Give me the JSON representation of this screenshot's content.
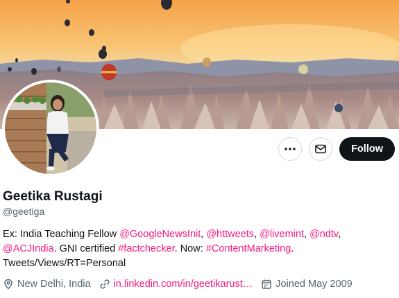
{
  "profile": {
    "name": "Geetika Rustagi",
    "handle": "@geetiga",
    "bio": [
      {
        "text": "Ex: India Teaching Fellow ",
        "link": false
      },
      {
        "text": "@GoogleNewsInit",
        "link": true
      },
      {
        "text": ", ",
        "link": false
      },
      {
        "text": "@httweets",
        "link": true
      },
      {
        "text": ", ",
        "link": false
      },
      {
        "text": "@livemint",
        "link": true
      },
      {
        "text": ", ",
        "link": false
      },
      {
        "text": "@ndtv",
        "link": true
      },
      {
        "text": ", ",
        "link": false
      },
      {
        "text": "@ACJIndia",
        "link": true
      },
      {
        "text": ". GNI certified ",
        "link": false
      },
      {
        "text": "#factchecker",
        "link": true
      },
      {
        "text": ". Now: ",
        "link": false
      },
      {
        "text": "#ContentMarketing",
        "link": true
      },
      {
        "text": ". Tweets/Views/RT=Personal",
        "link": false
      }
    ],
    "location": "New Delhi, India",
    "website": "in.linkedin.com/in/geetikarust…",
    "joined": "Joined May 2009"
  },
  "actions": {
    "more_icon": "more-horizontal-icon",
    "message_icon": "envelope-icon",
    "follow_label": "Follow"
  },
  "colors": {
    "accent": "#f91880",
    "text": "#0f1419",
    "secondary": "#536471",
    "follow_bg": "#0f1419",
    "border": "#cfd9de"
  }
}
